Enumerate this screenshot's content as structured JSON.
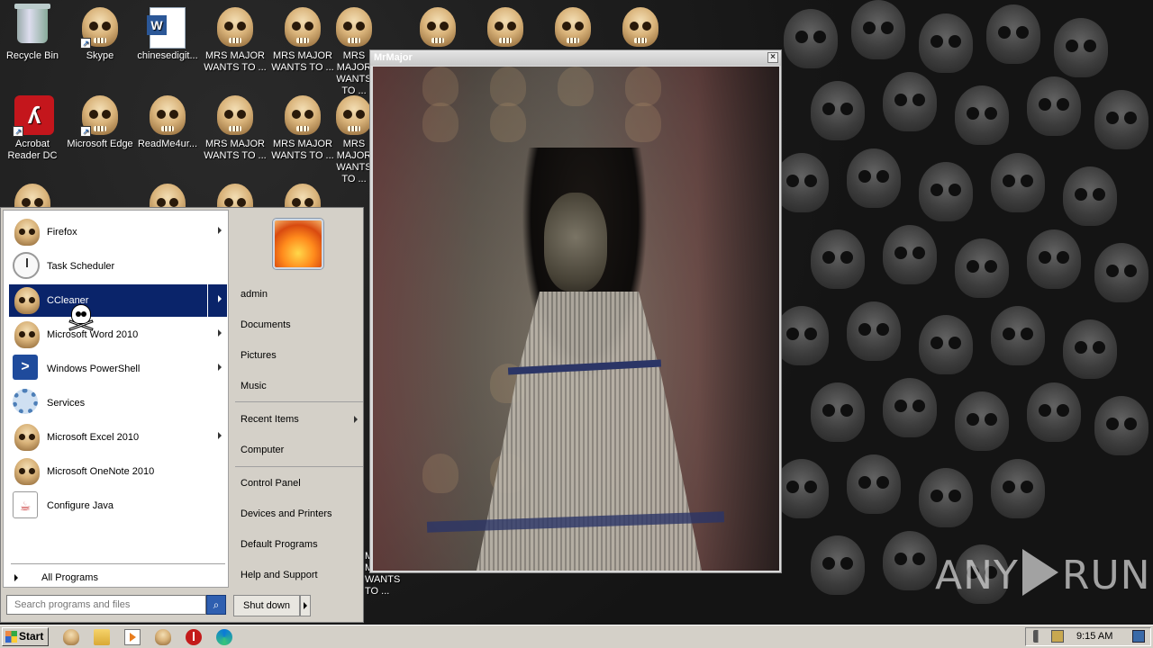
{
  "desktop": {
    "icons": [
      {
        "label": "Recycle Bin",
        "icon": "recycle-bin-icon"
      },
      {
        "label": "Skype",
        "icon": "skull-icon"
      },
      {
        "label": "chinesedigit...",
        "icon": "word-document-icon"
      },
      {
        "label": "MRS MAJOR WANTS TO ...",
        "icon": "skull-icon"
      },
      {
        "label": "Acrobat Reader DC",
        "icon": "acrobat-icon"
      },
      {
        "label": "Microsoft Edge",
        "icon": "skull-icon"
      },
      {
        "label": "ReadMe4ur...",
        "icon": "skull-icon"
      }
    ],
    "repeated_label": "MRS MAJOR WANTS TO ..."
  },
  "popup": {
    "title": "MrMajor",
    "close_glyph": "×"
  },
  "start_menu": {
    "programs": [
      {
        "label": "Firefox",
        "icon": "skull-icon",
        "has_submenu": true
      },
      {
        "label": "Task Scheduler",
        "icon": "clock-icon",
        "has_submenu": false
      },
      {
        "label": "CCleaner",
        "icon": "skull-icon",
        "has_submenu": true,
        "highlighted": true
      },
      {
        "label": "Microsoft Word 2010",
        "icon": "skull-icon",
        "has_submenu": true
      },
      {
        "label": "Windows PowerShell",
        "icon": "powershell-icon",
        "has_submenu": true
      },
      {
        "label": "Services",
        "icon": "gear-icon",
        "has_submenu": false
      },
      {
        "label": "Microsoft Excel 2010",
        "icon": "skull-icon",
        "has_submenu": true
      },
      {
        "label": "Microsoft OneNote 2010",
        "icon": "skull-icon",
        "has_submenu": false
      },
      {
        "label": "Configure Java",
        "icon": "java-icon",
        "has_submenu": false
      }
    ],
    "all_programs": "All Programs",
    "search_placeholder": "Search programs and files",
    "search_icon": "search-icon",
    "right_links": [
      {
        "label": "admin"
      },
      {
        "label": "Documents"
      },
      {
        "label": "Pictures"
      },
      {
        "label": "Music"
      },
      {
        "label": "Recent Items",
        "has_submenu": true
      },
      {
        "label": "Computer"
      },
      {
        "label": "Control Panel"
      },
      {
        "label": "Devices and Printers"
      },
      {
        "label": "Default Programs"
      },
      {
        "label": "Help and Support"
      }
    ],
    "shutdown_label": "Shut down"
  },
  "taskbar": {
    "start_label": "Start",
    "pinned": [
      "skull-icon",
      "folder-icon",
      "media-player-icon",
      "skull-icon",
      "stop-icon",
      "edge-icon"
    ],
    "clock": "9:15 AM"
  },
  "watermark": {
    "left": "ANY",
    "right": "RUN"
  }
}
